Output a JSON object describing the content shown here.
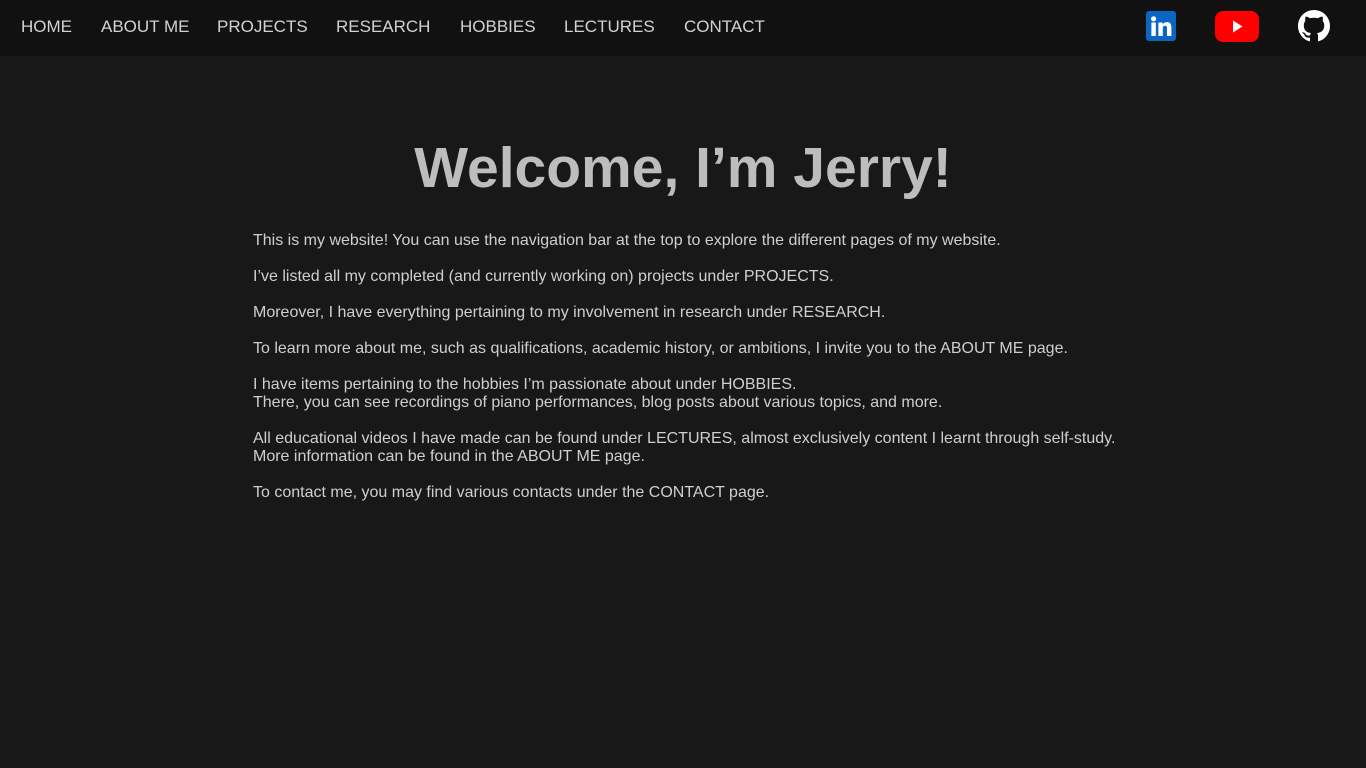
{
  "nav": {
    "items": [
      {
        "label": "HOME"
      },
      {
        "label": "ABOUT ME"
      },
      {
        "label": "PROJECTS"
      },
      {
        "label": "RESEARCH"
      },
      {
        "label": "HOBBIES"
      },
      {
        "label": "LECTURES"
      },
      {
        "label": "CONTACT"
      }
    ],
    "social": [
      {
        "icon": "linkedin-icon",
        "color": "#0A66C2"
      },
      {
        "icon": "youtube-icon",
        "color": "#FF0000"
      },
      {
        "icon": "github-icon",
        "color": "#FFFFFF"
      }
    ]
  },
  "main": {
    "title": "Welcome, I’m Jerry!",
    "paragraphs": [
      {
        "lines": [
          "This is my website! You can use the navigation bar at the top to explore the different pages of my website."
        ]
      },
      {
        "lines": [
          "I’ve listed all my completed (and currently working on) projects under PROJECTS."
        ]
      },
      {
        "lines": [
          "Moreover, I have everything pertaining to my involvement in research under RESEARCH."
        ]
      },
      {
        "lines": [
          "To learn more about me, such as qualifications, academic history, or ambitions, I invite you to the ABOUT ME page."
        ]
      },
      {
        "lines": [
          "I have items pertaining to the hobbies I’m passionate about under HOBBIES.",
          "There, you can see recordings of piano performances, blog posts about various topics, and more."
        ]
      },
      {
        "lines": [
          "All educational videos I have made can be found under LECTURES, almost exclusively content I learnt through self-study.",
          "More information can be found in the ABOUT ME page."
        ]
      },
      {
        "lines": [
          "To contact me, you may find various contacts under the CONTACT page."
        ]
      }
    ]
  },
  "colors": {
    "background": "#181818",
    "navbar": "#111111",
    "title": "#bdbdbd",
    "text": "#cfcfcf"
  }
}
